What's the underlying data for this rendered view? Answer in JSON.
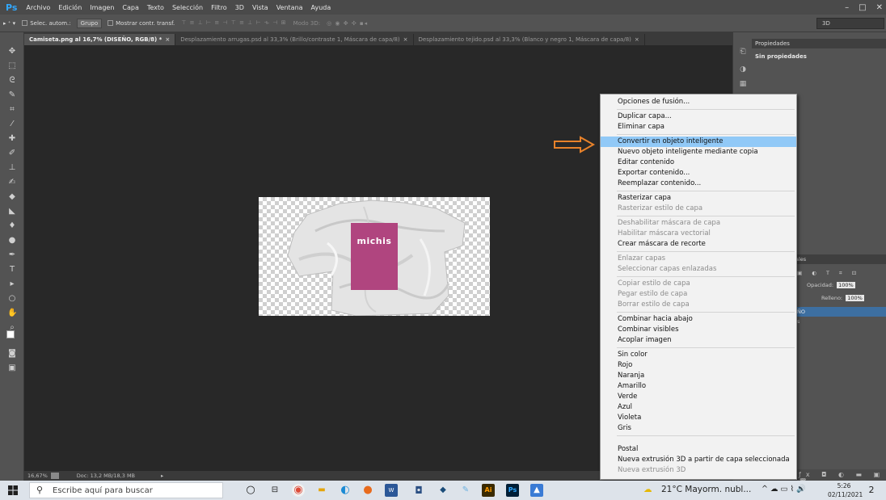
{
  "app": {
    "logo": "Ps"
  },
  "menubar": {
    "items": [
      "Archivo",
      "Edición",
      "Imagen",
      "Capa",
      "Texto",
      "Selección",
      "Filtro",
      "3D",
      "Vista",
      "Ventana",
      "Ayuda"
    ],
    "window_controls": [
      "–",
      "□",
      "✕"
    ]
  },
  "options_bar": {
    "tool": "▸ ⁺ ▾",
    "auto_select_label": "Selec. autom.:",
    "auto_select_value": "Grupo",
    "show_transform_label": "Mostrar contr. transf.",
    "align_icons": "⊤ ≡ ⊥  ⊢ ≡ ⊣  ⊤ ≡ ⊥  ⊢ ⟛ ⊣  ⊞",
    "mode_3d_label": "Modo 3D:",
    "mode_3d_icons": "◎ ◉ ✥ ✣ ▪◂",
    "search_3d": "3D"
  },
  "tabs": [
    {
      "label": "Camiseta.png al 16,7% (DISEÑO, RGB/8) *",
      "active": true
    },
    {
      "label": "Desplazamiento arrugas.psd al 33,3% (Brillo/contraste 1, Máscara de capa/8)",
      "active": false
    },
    {
      "label": "Desplazamiento tejido.psd al 33,3% (Blanco y negro 1, Máscara de capa/8)",
      "active": false
    }
  ],
  "canvas": {
    "label_text": "michis",
    "label_color": "#b0457f"
  },
  "status_bar": {
    "zoom": "16,67%",
    "doc_info": "Doc: 13,2 MB/18,3 MB"
  },
  "properties_panel": {
    "title": "Propiedades",
    "empty_text": "Sin propiedades"
  },
  "layers_panel": {
    "tab_fragment": "ales",
    "opacity_label": "Opacidad:",
    "opacity_value": "100%",
    "fill_label": "Relleno:",
    "fill_value": "100%",
    "selected_layer_fragment": "ÑO",
    "second_layer_fragment": "s"
  },
  "context_menu": {
    "groups": [
      [
        {
          "label": "Opciones de fusión...",
          "enabled": true
        }
      ],
      [
        {
          "label": "Duplicar capa...",
          "enabled": true
        },
        {
          "label": "Eliminar capa",
          "enabled": true
        }
      ],
      [
        {
          "label": "Convertir en objeto inteligente",
          "enabled": true,
          "highlighted": true
        },
        {
          "label": "Nuevo objeto inteligente mediante copia",
          "enabled": true
        },
        {
          "label": "Editar contenido",
          "enabled": true
        },
        {
          "label": "Exportar contenido...",
          "enabled": true
        },
        {
          "label": "Reemplazar contenido...",
          "enabled": true
        }
      ],
      [
        {
          "label": "Rasterizar capa",
          "enabled": true
        },
        {
          "label": "Rasterizar estilo de capa",
          "enabled": false
        }
      ],
      [
        {
          "label": "Deshabilitar máscara de capa",
          "enabled": false
        },
        {
          "label": "Habilitar máscara vectorial",
          "enabled": false
        },
        {
          "label": "Crear máscara de recorte",
          "enabled": true
        }
      ],
      [
        {
          "label": "Enlazar capas",
          "enabled": false
        },
        {
          "label": "Seleccionar capas enlazadas",
          "enabled": false
        }
      ],
      [
        {
          "label": "Copiar estilo de capa",
          "enabled": false
        },
        {
          "label": "Pegar estilo de capa",
          "enabled": false
        },
        {
          "label": "Borrar estilo de capa",
          "enabled": false
        }
      ],
      [
        {
          "label": "Combinar hacia abajo",
          "enabled": true
        },
        {
          "label": "Combinar visibles",
          "enabled": true
        },
        {
          "label": "Acoplar imagen",
          "enabled": true
        }
      ],
      [
        {
          "label": "Sin color",
          "enabled": true
        },
        {
          "label": "Rojo",
          "enabled": true
        },
        {
          "label": "Naranja",
          "enabled": true
        },
        {
          "label": "Amarillo",
          "enabled": true
        },
        {
          "label": "Verde",
          "enabled": true
        },
        {
          "label": "Azul",
          "enabled": true
        },
        {
          "label": "Violeta",
          "enabled": true
        },
        {
          "label": "Gris",
          "enabled": true
        }
      ],
      [
        {
          "label": "Postal",
          "enabled": true
        },
        {
          "label": "Nueva extrusión 3D a partir de capa seleccionada",
          "enabled": true
        },
        {
          "label": "Nueva extrusión 3D",
          "enabled": false
        }
      ]
    ]
  },
  "taskbar": {
    "search_placeholder": "Escribe aquí para buscar",
    "weather": "21°C  Mayorm. nubl...",
    "tray_icons": "^ ☁ ▭ ⌇ 🔊",
    "time": "5:26",
    "date": "02/11/2021",
    "notification_count": "2"
  },
  "colors": {
    "arrow": "#e8822a",
    "highlight": "#91c9f7",
    "layer_selected": "#3d6fa1"
  }
}
